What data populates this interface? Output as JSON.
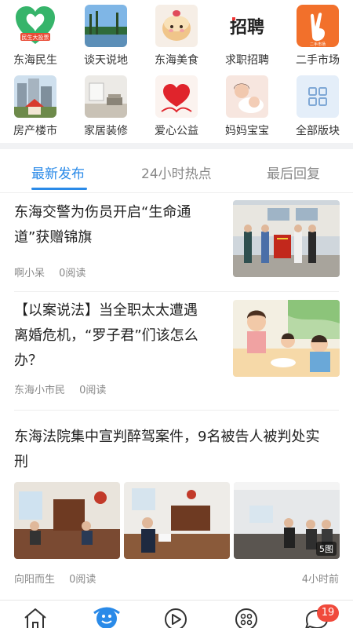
{
  "categories": [
    {
      "label": "东海民生",
      "icon": "minsheng-logo-icon",
      "logo_text": "民生大投票"
    },
    {
      "label": "谈天说地",
      "icon": "landscape-photo-icon"
    },
    {
      "label": "东海美食",
      "icon": "cake-photo-icon"
    },
    {
      "label": "求职招聘",
      "icon": "recruit-text-icon",
      "logo_text": "招聘"
    },
    {
      "label": "二手市场",
      "icon": "victory-hand-icon",
      "logo_text": "二手市场"
    },
    {
      "label": "房产楼市",
      "icon": "buildings-photo-icon"
    },
    {
      "label": "家居装修",
      "icon": "interior-photo-icon"
    },
    {
      "label": "爱心公益",
      "icon": "heart-charity-icon"
    },
    {
      "label": "妈妈宝宝",
      "icon": "mother-baby-photo-icon"
    },
    {
      "label": "全部版块",
      "icon": "grid-all-icon"
    }
  ],
  "tabs": [
    {
      "label": "最新发布",
      "active": true
    },
    {
      "label": "24小时热点",
      "active": false
    },
    {
      "label": "最后回复",
      "active": false
    }
  ],
  "posts": [
    {
      "title_line1": "东海交警为伤员开启“生命通",
      "title_line2": "道”获赠锦旗",
      "author": "啊小呆",
      "reads": "0阅读"
    },
    {
      "title_line1": "【以案说法】当全职太太遭遇",
      "title_line2": "离婚危机，“罗子君”们该怎么",
      "title_line3": "办？",
      "author": "东海小市民",
      "reads": "0阅读"
    },
    {
      "title_line1": "东海法院集中宣判醉驾案件，9名被告人被判处实",
      "title_line2": "刑",
      "author": "向阳而生",
      "reads": "0阅读",
      "time": "4小时前",
      "image_count": "5图"
    }
  ],
  "bottom_nav": [
    {
      "icon": "home-icon"
    },
    {
      "icon": "community-icon",
      "active": true
    },
    {
      "icon": "video-icon"
    },
    {
      "icon": "apps-icon"
    },
    {
      "icon": "message-icon",
      "badge": "19"
    }
  ],
  "colors": {
    "accent": "#2a8ae8",
    "badge": "#f04a3c"
  }
}
